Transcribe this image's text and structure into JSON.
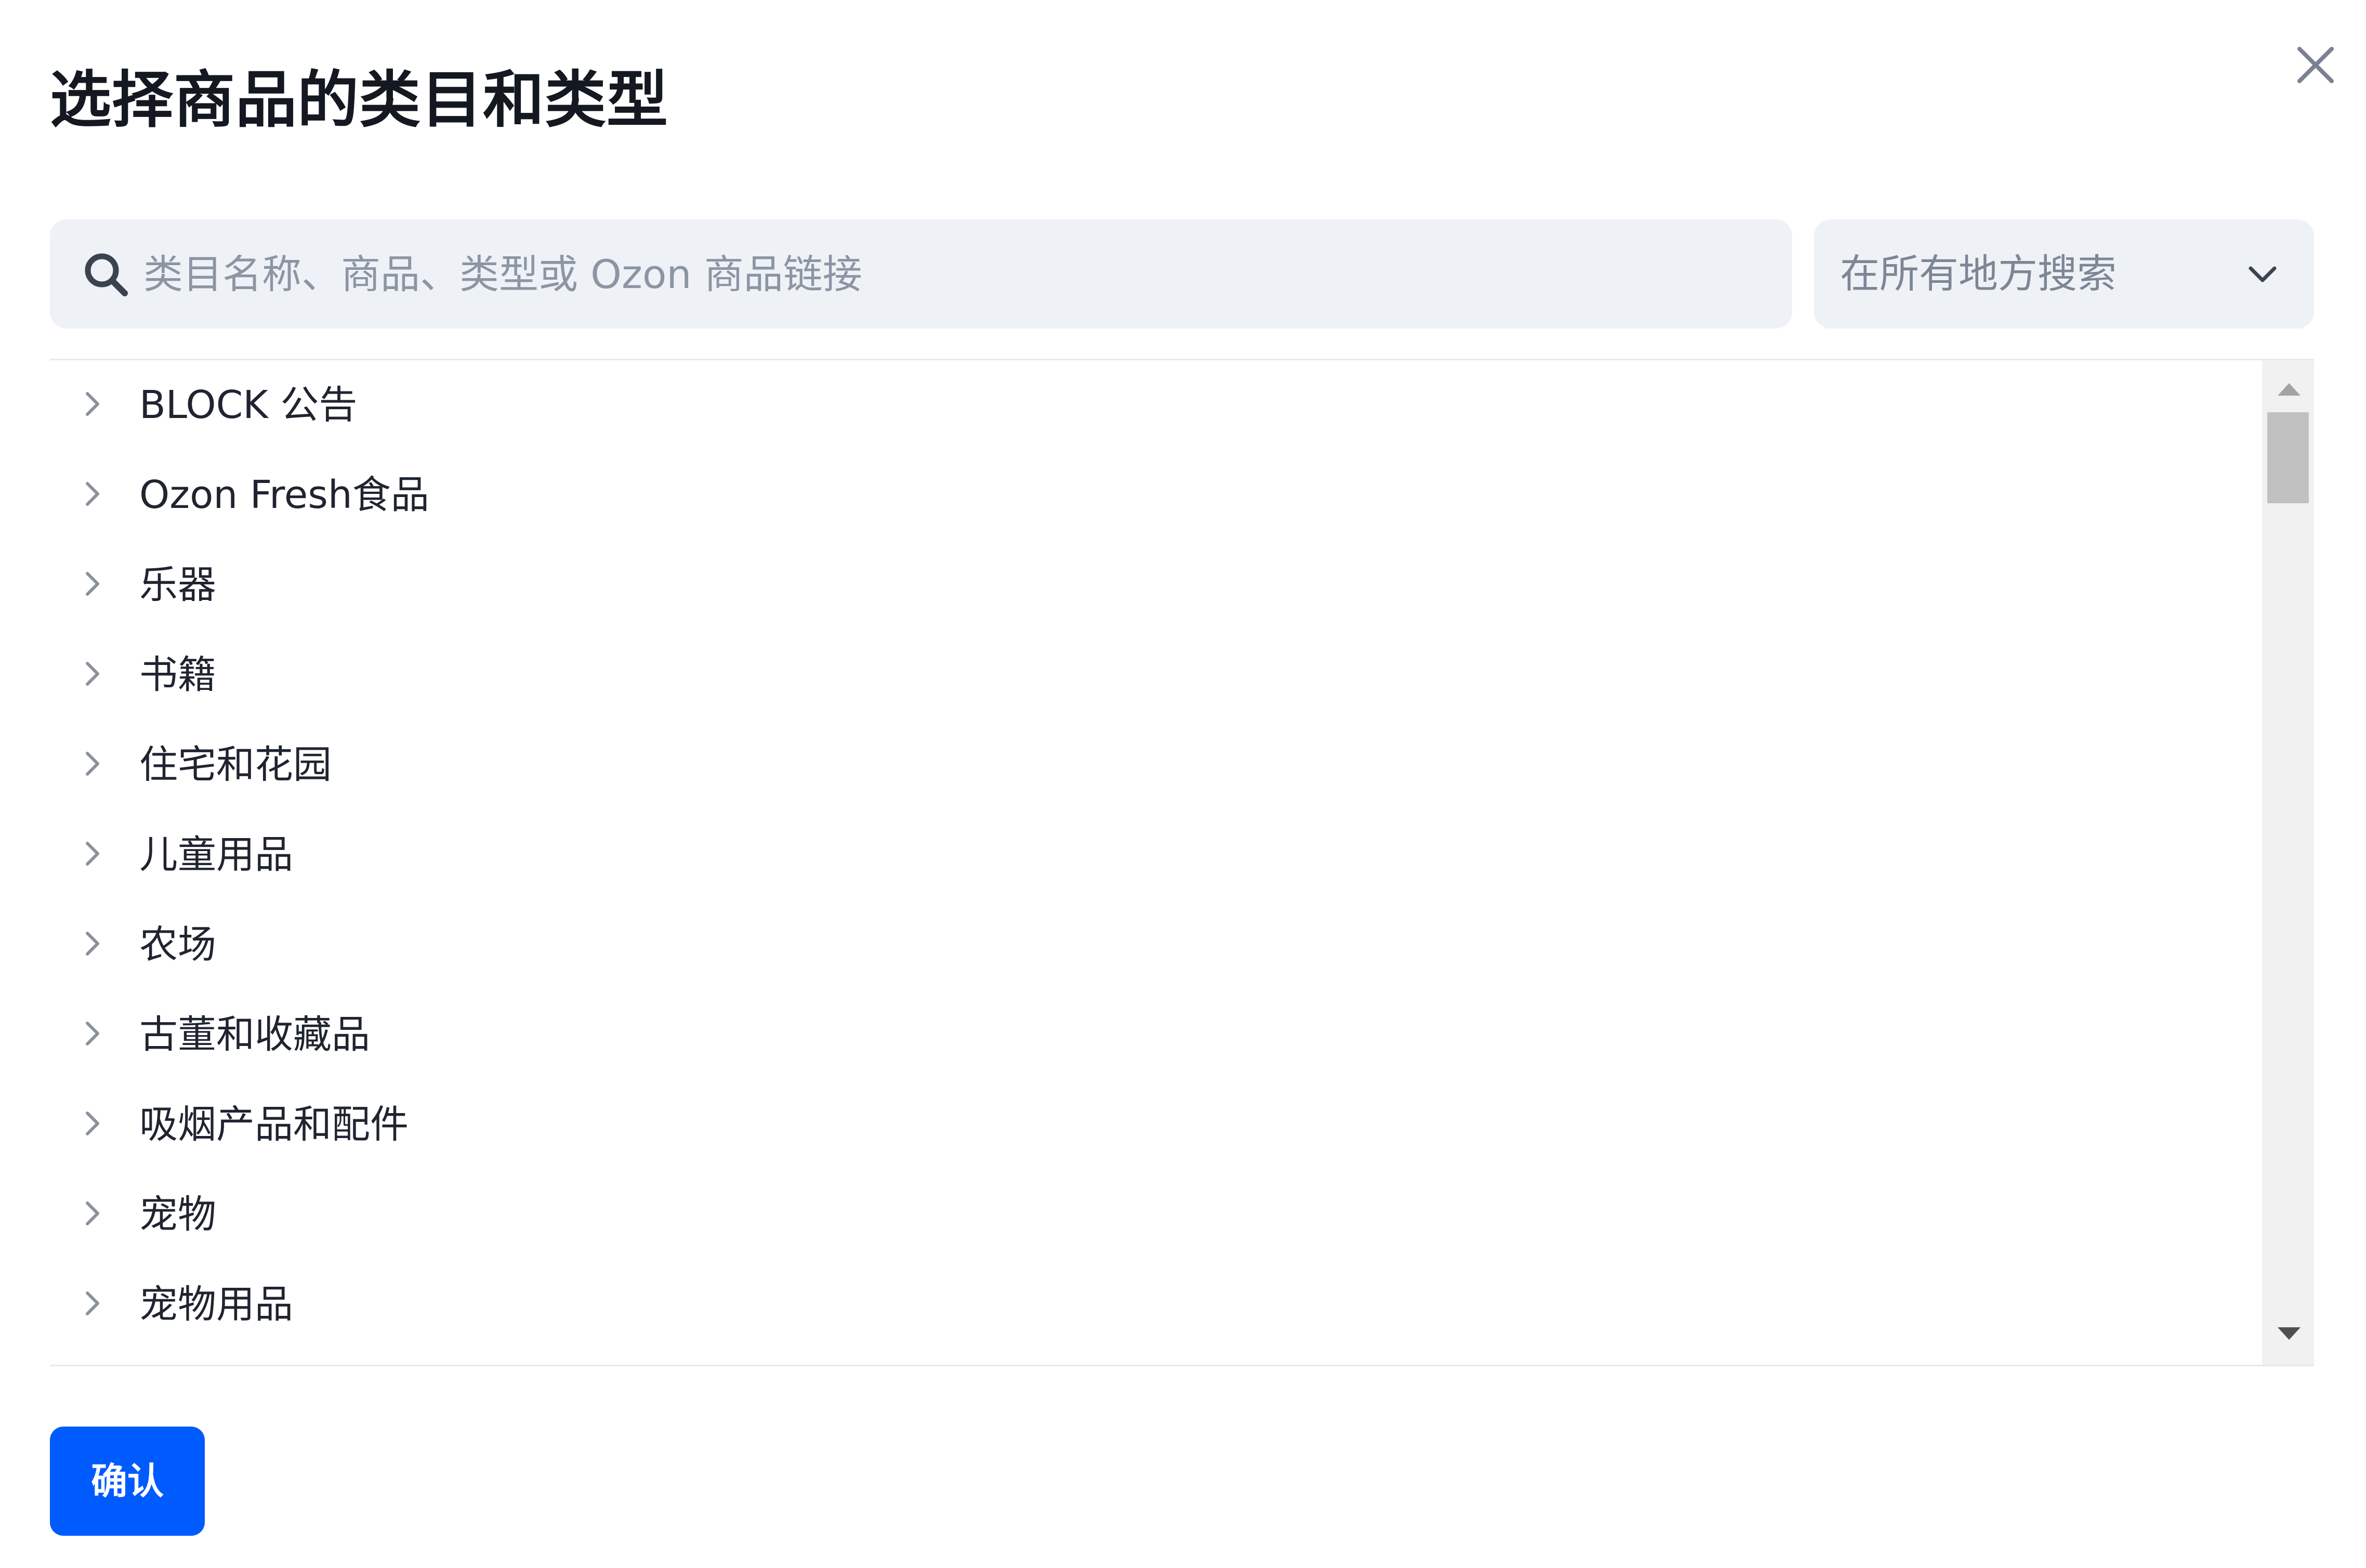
{
  "dialog": {
    "title": "选择商品的类目和类型",
    "close_icon": "close-icon"
  },
  "search": {
    "placeholder": "类目名称、商品、类型或 Ozon 商品链接",
    "value": "",
    "icon": "search-icon"
  },
  "scope": {
    "selected": "在所有地方搜索",
    "icon": "chevron-down-icon"
  },
  "categories": [
    {
      "label": "BLOCK 公告"
    },
    {
      "label": "Ozon Fresh食品"
    },
    {
      "label": "乐器"
    },
    {
      "label": "书籍"
    },
    {
      "label": "住宅和花园"
    },
    {
      "label": "儿童用品"
    },
    {
      "label": "农场"
    },
    {
      "label": "古董和收藏品"
    },
    {
      "label": "吸烟产品和配件"
    },
    {
      "label": "宠物"
    },
    {
      "label": "宠物用品"
    }
  ],
  "actions": {
    "confirm_label": "确认"
  },
  "colors": {
    "accent": "#005bff",
    "input_background": "#eef2f7",
    "text_primary": "#1b1f2a",
    "text_placeholder": "#8c95a3"
  }
}
